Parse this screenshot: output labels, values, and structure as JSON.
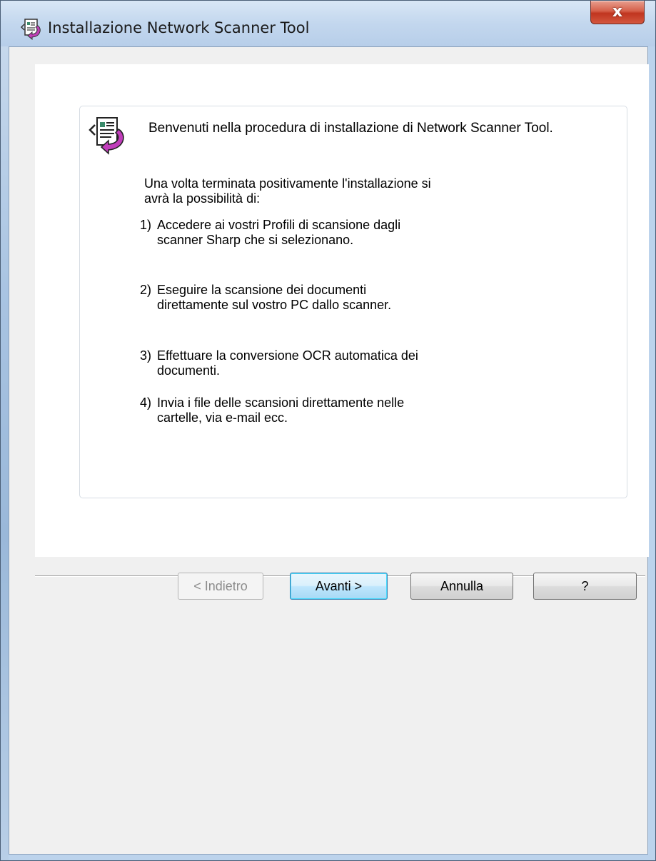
{
  "window": {
    "title": "Installazione Network Scanner Tool",
    "close_label": "x"
  },
  "welcome": {
    "title": "Benvenuti nella procedura di installazione di Network Scanner Tool.",
    "intro_line1": "Una volta terminata positivamente l'installazione si",
    "intro_line2": "avrà la possibilità di:",
    "items": [
      {
        "num": "1)",
        "line1": "Accedere ai vostri Profili di scansione dagli",
        "line2": "scanner Sharp che si selezionano."
      },
      {
        "num": "2)",
        "line1": "Eseguire la scansione dei documenti",
        "line2": "direttamente sul vostro PC dallo scanner."
      },
      {
        "num": "3)",
        "line1": "Effettuare la conversione OCR automatica dei",
        "line2": "documenti."
      },
      {
        "num": "4)",
        "line1": "Invia i file delle scansioni direttamente nelle",
        "line2": "cartelle, via e-mail ecc."
      }
    ]
  },
  "buttons": {
    "back_label": "< Indietro",
    "next_label": "Avanti >",
    "cancel_label": "Annulla",
    "help_label": "?"
  },
  "colors": {
    "accent": "#3c7fb1",
    "close_red": "#c0351f"
  }
}
